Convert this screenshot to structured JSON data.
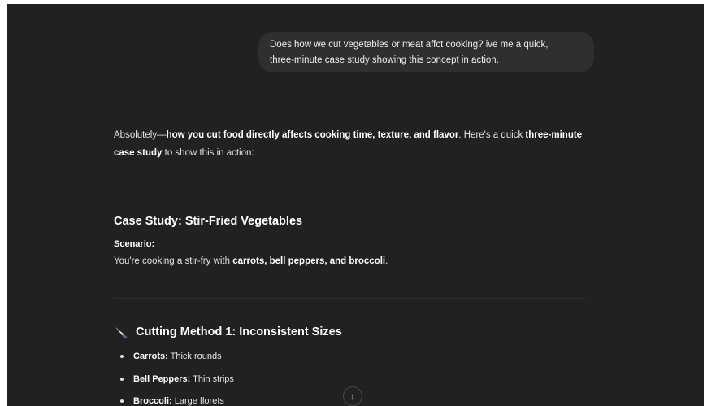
{
  "user_message": {
    "line1": "Does how we cut vegetables or meat affct cooking? ive me a quick,",
    "line2": "three-minute case study showing this concept in action."
  },
  "assistant": {
    "intro": {
      "part1": "Absolutely—",
      "bold1": "how you cut food directly affects cooking time, texture, and flavor",
      "part2": ". Here's a quick ",
      "bold2": "three-minute case study",
      "part3": " to show this in action:"
    },
    "case_study_heading": "Case Study: Stir-Fried Vegetables",
    "scenario_label": "Scenario:",
    "scenario": {
      "part1": "You're cooking a stir-fry with ",
      "bold": "carrots, bell peppers, and broccoli",
      "part2": "."
    },
    "method1": {
      "icon": "knife-icon",
      "heading": "Cutting Method 1: Inconsistent Sizes",
      "items": [
        {
          "label": "Carrots:",
          "text": " Thick rounds"
        },
        {
          "label": "Bell Peppers:",
          "text": " Thin strips"
        },
        {
          "label": "Broccoli:",
          "text": " Large florets"
        }
      ]
    }
  },
  "scroll_button": {
    "icon": "arrow-down-icon",
    "glyph": "↓"
  }
}
